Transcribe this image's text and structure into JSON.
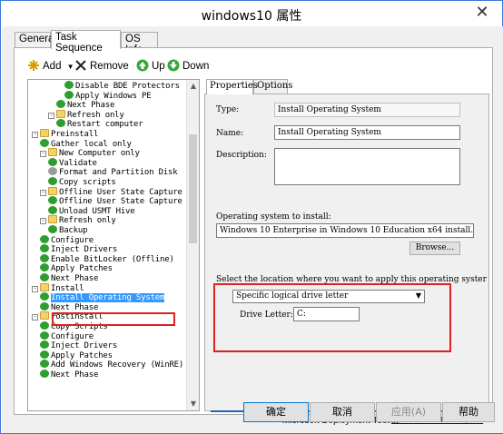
{
  "window": {
    "title": "windows10 属性",
    "close_glyph": "✕"
  },
  "tabs": [
    {
      "label": "General"
    },
    {
      "label": "Task Sequence"
    },
    {
      "label": "OS Info"
    }
  ],
  "toolbar": {
    "add": "Add",
    "remove": "Remove",
    "up": "Up",
    "down": "Down"
  },
  "tree": {
    "items": [
      {
        "label": "Disable BDE Protectors"
      },
      {
        "label": "Apply Windows PE"
      },
      {
        "label": "Next Phase"
      },
      {
        "label": "Refresh only"
      },
      {
        "label": "Restart computer"
      },
      {
        "label": "Preinstall"
      },
      {
        "label": "Gather local only"
      },
      {
        "label": "New Computer only"
      },
      {
        "label": "Validate"
      },
      {
        "label": "Format and Partition Disk"
      },
      {
        "label": "Copy scripts"
      },
      {
        "label": "Offline User State Capture"
      },
      {
        "label": "Offline User State Capture"
      },
      {
        "label": "Unload USMT Hive"
      },
      {
        "label": "Refresh only"
      },
      {
        "label": "Backup"
      },
      {
        "label": "Configure"
      },
      {
        "label": "Inject Drivers"
      },
      {
        "label": "Enable BitLocker (Offline)"
      },
      {
        "label": "Apply Patches"
      },
      {
        "label": "Next Phase"
      },
      {
        "label": "Install"
      },
      {
        "label": "Install Operating System"
      },
      {
        "label": "Next Phase"
      },
      {
        "label": "Postinstall"
      },
      {
        "label": "Copy Scripts"
      },
      {
        "label": "Configure"
      },
      {
        "label": "Inject Drivers"
      },
      {
        "label": "Apply Patches"
      },
      {
        "label": "Add Windows Recovery (WinRE)"
      },
      {
        "label": "Next Phase"
      }
    ]
  },
  "props": {
    "tabs": [
      {
        "label": "Properties"
      },
      {
        "label": "Options"
      }
    ],
    "type_label": "Type:",
    "type_value": "Install Operating System",
    "name_label": "Name:",
    "name_value": "Install Operating System",
    "desc_label": "Description:",
    "desc_value": "",
    "os_label": "Operating system to install:",
    "os_value": "Windows 10 Enterprise in Windows 10 Education x64 install.w",
    "browse": "Browse...",
    "location_label": "Select the location where you want to apply this operating syster",
    "location_value": "Specific logical drive letter",
    "drive_label": "Drive Letter:",
    "drive_value": "C:",
    "mdt": "Microsoft Deployment Toolkit",
    "url": "www.microsoft.com/mdt"
  },
  "buttons": {
    "ok": "确定",
    "cancel": "取消",
    "apply": "应用(A)",
    "help": "帮助"
  },
  "colors": {
    "accent": "#3399ff",
    "highlight_box": "#e02020",
    "check": "#2e9e2e"
  }
}
